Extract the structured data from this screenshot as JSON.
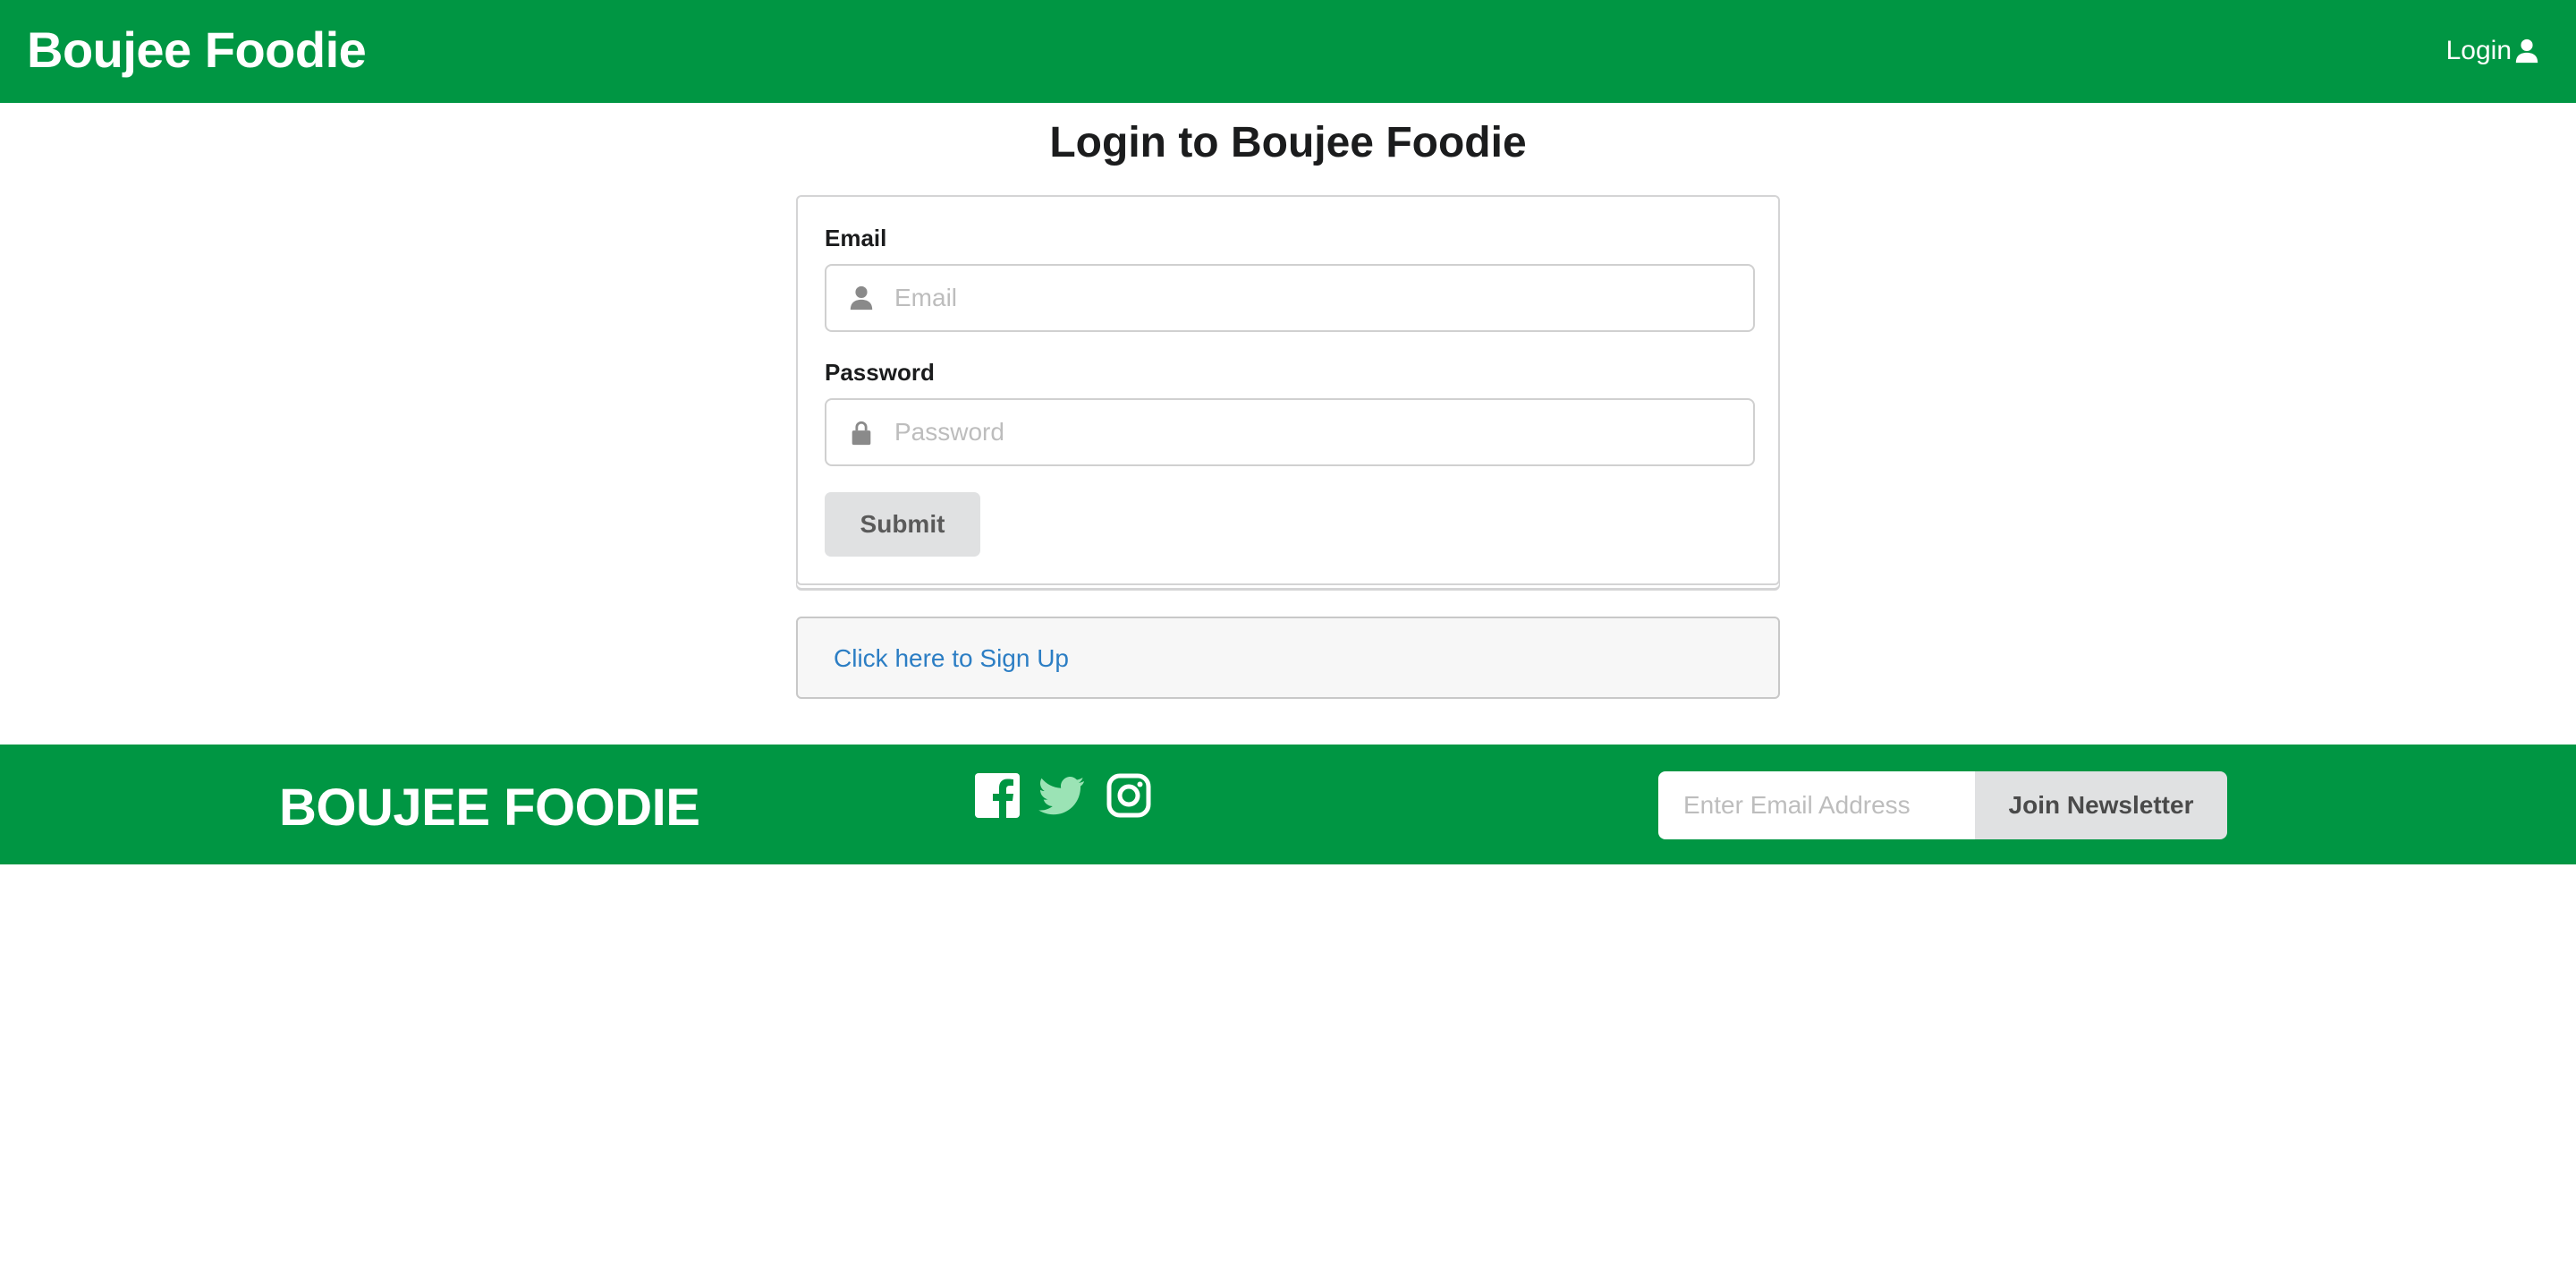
{
  "header": {
    "brand": "Boujee Foodie",
    "login_label": "Login",
    "login_icon": "user-icon"
  },
  "main": {
    "title": "Login to Boujee Foodie",
    "email": {
      "label": "Email",
      "placeholder": "Email",
      "value": "",
      "icon": "user-icon"
    },
    "password": {
      "label": "Password",
      "placeholder": "Password",
      "value": "",
      "icon": "lock-icon"
    },
    "submit_label": "Submit",
    "signup_link": "Click here to Sign Up"
  },
  "footer": {
    "brand": "BOUJEE FOODIE",
    "social_icons": [
      "facebook-icon",
      "twitter-icon",
      "instagram-icon"
    ],
    "newsletter_placeholder": "Enter Email Address",
    "newsletter_button": "Join Newsletter"
  },
  "colors": {
    "brand_green": "#009643",
    "link_blue": "#2c7ec4",
    "button_gray": "#e0e1e2"
  }
}
